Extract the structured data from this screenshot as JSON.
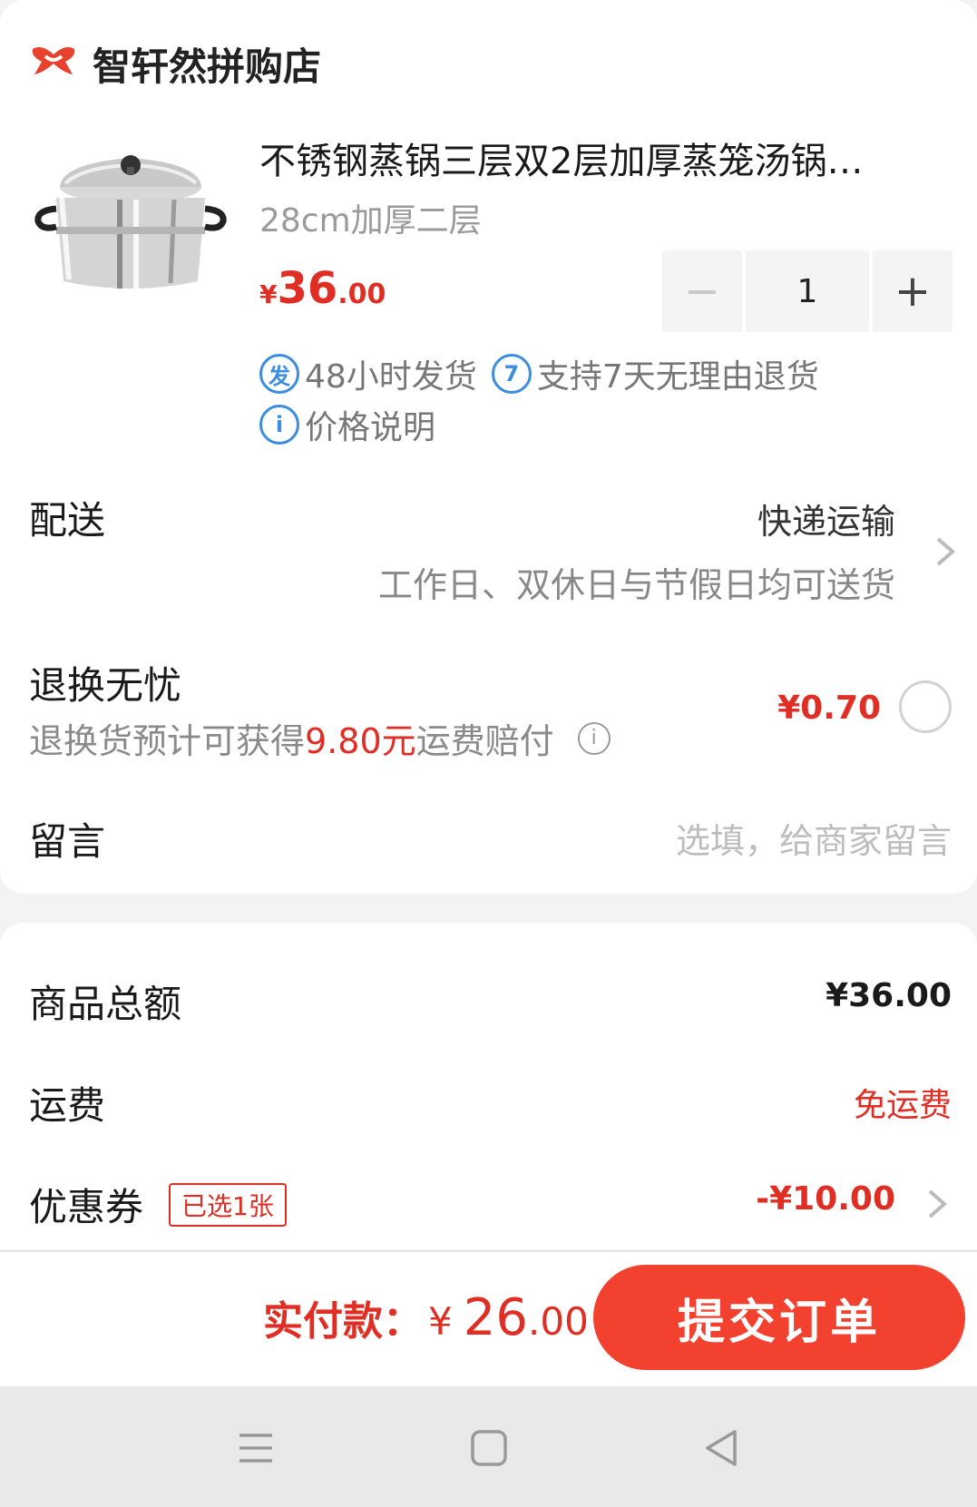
{
  "shop": {
    "name": "智轩然拼购店",
    "logo_icon": "shop-logo-icon",
    "accent": "#e02e24"
  },
  "product": {
    "title": "不锈钢蒸锅三层双2层加厚蒸笼汤锅…",
    "spec": "28cm加厚二层",
    "price_currency": "¥",
    "price_int": "36",
    "price_dec": ".00",
    "quantity": "1",
    "minus_label": "−",
    "plus_label": "+",
    "tags": [
      {
        "icon": "发",
        "text": "48小时发货"
      },
      {
        "icon": "7",
        "text": "支持7天无理由退货"
      },
      {
        "icon": "i",
        "text": "价格说明"
      }
    ]
  },
  "delivery": {
    "label": "配送",
    "method": "快递运输",
    "note": "工作日、双休日与节假日均可送货"
  },
  "returns": {
    "label": "退换无忧",
    "sub_prefix": "退换货预计可获得",
    "sub_amount": "9.80元",
    "sub_suffix": "运费赔付",
    "price": "¥0.70",
    "selected": false
  },
  "message": {
    "label": "留言",
    "placeholder": "选填，给商家留言"
  },
  "summary": {
    "goods_label": "商品总额",
    "goods_value": "¥36.00",
    "shipping_label": "运费",
    "shipping_value": "免运费",
    "coupon_label": "优惠券",
    "coupon_badge": "已选1张",
    "coupon_value": "-¥10.00"
  },
  "paybar": {
    "label": "实付款：",
    "currency": "¥",
    "int": "26",
    "dec": ".00",
    "submit_label": "提交订单",
    "submit_color": "#f2412e"
  },
  "navbar": {
    "icons": [
      "menu-icon",
      "home-icon",
      "back-icon"
    ]
  }
}
